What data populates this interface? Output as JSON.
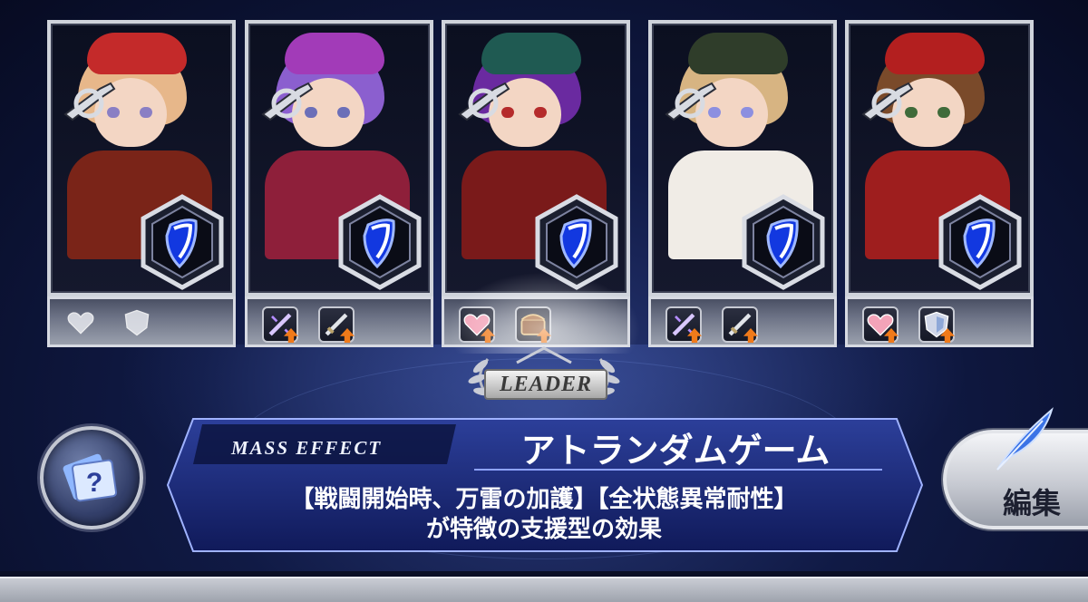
{
  "party": [
    {
      "id": "slot-1",
      "weapon_icon": "gun-icon",
      "hair": "#e7b78a",
      "hat": "#c42a2a",
      "eyes": "#8a7fc4",
      "outfit": "#7a2418",
      "skills": [
        {
          "icon": "heart-up-icon",
          "active": false
        },
        {
          "icon": "shield-up-icon",
          "active": false
        }
      ]
    },
    {
      "id": "slot-2",
      "weapon_icon": "gun-icon",
      "hair": "#8b5fcf",
      "hat": "#a23bb8",
      "eyes": "#6b6fb8",
      "outfit": "#8e1f3a",
      "skills": [
        {
          "icon": "sword-magic-up-icon",
          "active": true
        },
        {
          "icon": "sword-up-icon",
          "active": true
        }
      ]
    },
    {
      "id": "slot-3",
      "weapon_icon": "gun-icon",
      "hair": "#6a2aa0",
      "hat": "#1f5a52",
      "eyes": "#b52b2b",
      "outfit": "#7a1a1a",
      "skills": [
        {
          "icon": "heart-up-icon",
          "active": true
        },
        {
          "icon": "chest-up-icon",
          "active": true
        }
      ]
    },
    {
      "id": "slot-4",
      "weapon_icon": "gun-icon",
      "hair": "#d7b482",
      "hat": "#2f3d2a",
      "eyes": "#8c8fe0",
      "outfit": "#f0ece6",
      "skills": [
        {
          "icon": "sword-magic-up-icon",
          "active": true
        },
        {
          "icon": "sword-up-icon",
          "active": true
        }
      ]
    },
    {
      "id": "slot-5",
      "weapon_icon": "gun-icon",
      "hair": "#7a4a2a",
      "hat": "#b31f1f",
      "eyes": "#3f6b3a",
      "outfit": "#9e1e1e",
      "skills": [
        {
          "icon": "heart-up-icon",
          "active": true
        },
        {
          "icon": "shield-up-icon",
          "active": true
        }
      ]
    }
  ],
  "leader": {
    "label": "LEADER",
    "slot": "slot-3"
  },
  "mass_effect": {
    "header": "MASS EFFECT",
    "name": "アトランダムゲーム",
    "description_line1": "【戦闘開始時、万雷の加護】【全状態異常耐性】",
    "description_line2": "が特徴の支援型の効果"
  },
  "buttons": {
    "help_icon": "card-question-icon",
    "edit_label": "編集",
    "edit_icon": "quill-icon"
  },
  "colors": {
    "shield": "#1238e0",
    "skill_arrow": "#f07a1a",
    "panel": "#1a2a7a"
  }
}
